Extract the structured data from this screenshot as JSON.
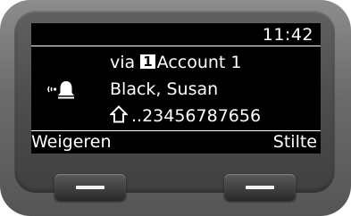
{
  "status_bar": {
    "time": "11:42"
  },
  "call": {
    "via_prefix": "via",
    "account_number": "1",
    "account_name": "Account 1",
    "caller_name": "Black, Susan",
    "caller_number": "..23456787656",
    "ring_icon": "ringing-bell-icon",
    "number_type_icon": "home-icon"
  },
  "softkeys": {
    "left_label": "Weigeren",
    "right_label": "Stilte"
  },
  "colors": {
    "screen_background": "#000000",
    "screen_text": "#ffffff",
    "housing": "#6b6b6b"
  }
}
